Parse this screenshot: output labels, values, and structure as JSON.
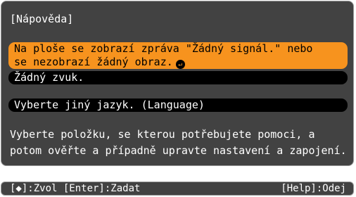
{
  "window": {
    "title": "[Nápověda]"
  },
  "menu": {
    "items": [
      {
        "lines": [
          "Na ploše se zobrazí zpráva \"Žádný signál.\" nebo",
          "se nezobrazí žádný obraz."
        ],
        "selected": true,
        "enter_icon": "enter-return-icon"
      },
      {
        "lines": [
          "Žádný zvuk."
        ],
        "selected": false
      },
      {
        "lines": [
          "Vyberte jiný jazyk. (Language)"
        ],
        "selected": false
      }
    ]
  },
  "description": {
    "line1": "Vyberte položku, se kterou potřebujete pomoci, a",
    "line2": "potom ověřte a případně upravte nastavení a zapojení."
  },
  "footer": {
    "left": "[◆]:Zvol [Enter]:Zadat",
    "right": "[Help]:Odej"
  },
  "colors": {
    "panel_bg": "#424242",
    "highlight": "#f7931e",
    "item_bg": "#000000",
    "text": "#ffffff"
  }
}
